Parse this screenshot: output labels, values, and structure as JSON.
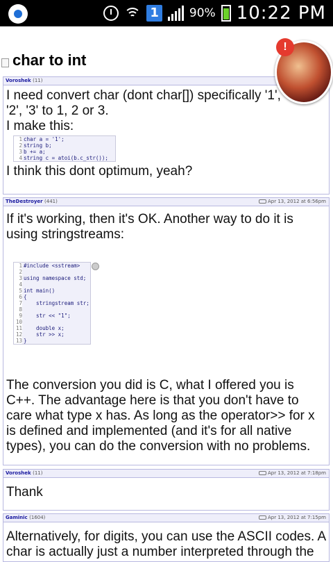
{
  "status_bar": {
    "app_notification_icon": "messenger-icon",
    "alarm_icon": "alarm-icon",
    "wifi_icon": "wifi-icon",
    "notification_badge": "1",
    "signal_icon": "signal-icon",
    "battery_percent": "90%",
    "time": "10:22 PM"
  },
  "page": {
    "title": "char to int",
    "page_icon": "document-icon"
  },
  "chat_head": {
    "badge": "!",
    "icon": "avatar-icon"
  },
  "posts": [
    {
      "user": "Voroshek",
      "rep": "(11)",
      "date": "",
      "text1": "I need convert char (dont char[]) specifically '1', '2', '3' to 1, 2 or 3.",
      "text2": "I make this:",
      "code": [
        {
          "n": "1",
          "line": "char a = '1';"
        },
        {
          "n": "2",
          "line": "string b;"
        },
        {
          "n": "3",
          "line": "b += a;"
        },
        {
          "n": "4",
          "line": "string c = atoi(b.c_str());"
        }
      ],
      "text3": "I think this dont optimum, yeah?"
    },
    {
      "user": "TheDestroyer",
      "rep": "(441)",
      "date": "Apr 13, 2012 at 6:56pm",
      "text1": "If it's working, then it's OK. Another way to do it is using stringstreams:",
      "code": [
        {
          "n": "1",
          "line": "#include <sstream>"
        },
        {
          "n": "2",
          "line": ""
        },
        {
          "n": "3",
          "line": "using namespace std;"
        },
        {
          "n": "4",
          "line": ""
        },
        {
          "n": "5",
          "line": "int main()"
        },
        {
          "n": "6",
          "line": "{"
        },
        {
          "n": "7",
          "line": "    stringstream str;"
        },
        {
          "n": "8",
          "line": ""
        },
        {
          "n": "9",
          "line": "    str << \"1\";"
        },
        {
          "n": "10",
          "line": ""
        },
        {
          "n": "11",
          "line": "    double x;"
        },
        {
          "n": "12",
          "line": "    str >> x;"
        },
        {
          "n": "13",
          "line": "}"
        }
      ],
      "text2": "The conversion you did is C, what I offered you is C++. The advantage here is that you don't have to care what type x has. As long as the operator>> for x is defined and implemented (and it's for all native types), you can do the conversion with no problems."
    },
    {
      "user": "Voroshek",
      "rep": "(11)",
      "date": "Apr 13, 2012 at 7:18pm",
      "text1": "Thank"
    },
    {
      "user": "Gaminic",
      "rep": "(1604)",
      "date": "Apr 13, 2012 at 7:15pm",
      "text1": "Alternatively, for digits, you can use the ASCII codes. A char is actually just a number interpreted through the"
    }
  ]
}
